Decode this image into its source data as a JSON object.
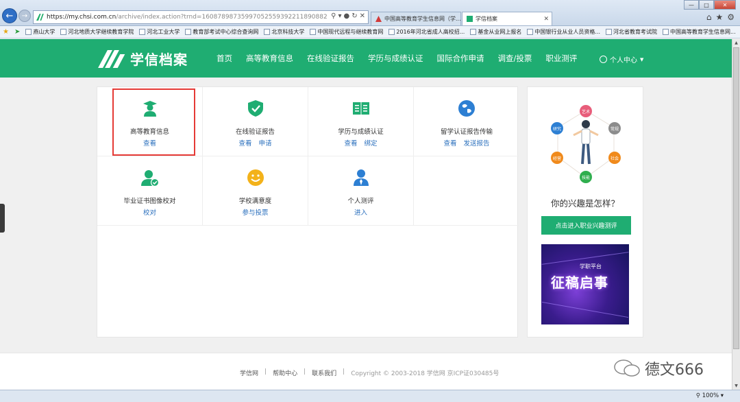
{
  "browser": {
    "url_main": "https://my.chsi.com.cn",
    "url_rest": "/archive/index.action?trnd=16087898735997052559392211890882",
    "tabs": [
      {
        "label": "中国高等教育学生信息网（学..."
      },
      {
        "label": "学信档案"
      }
    ],
    "favorites": [
      "燕山大学",
      "河北地质大学继续教育学院",
      "河北工业大学",
      "教育部考试中心综合查询网",
      "北京科技大学",
      "中国现代远程与继续教育网",
      "2016年河北省成人高校招...",
      "基金从业网上报名",
      "中国银行业从业人员资格...",
      "河北省教育考试院",
      "中国高等教育学生信息网..."
    ],
    "zoom": "100%"
  },
  "header": {
    "logo_text": "学信档案",
    "nav": [
      "首页",
      "高等教育信息",
      "在线验证报告",
      "学历与成绩认证",
      "国际合作申请",
      "调查/投票",
      "职业测评"
    ],
    "user_center": "个人中心"
  },
  "grid": [
    {
      "title": "高等教育信息",
      "links": [
        "查看"
      ],
      "icon": "graduate-icon",
      "color": "#1fad72"
    },
    {
      "title": "在线验证报告",
      "links": [
        "查看",
        "申请"
      ],
      "icon": "shield-check-icon",
      "color": "#1fad72"
    },
    {
      "title": "学历与成绩认证",
      "links": [
        "查看",
        "绑定"
      ],
      "icon": "book-icon",
      "color": "#1fad72"
    },
    {
      "title": "留学认证报告传输",
      "links": [
        "查看",
        "发送报告"
      ],
      "icon": "globe-icon",
      "color": "#2d7fd3"
    },
    {
      "title": "毕业证书图像校对",
      "links": [
        "校对"
      ],
      "icon": "user-check-icon",
      "color": "#1fad72"
    },
    {
      "title": "学校满意度",
      "links": [
        "参与投票"
      ],
      "icon": "smiley-icon",
      "color": "#f3b21a"
    },
    {
      "title": "个人测评",
      "links": [
        "进入"
      ],
      "icon": "person-tie-icon",
      "color": "#2d7fd3"
    }
  ],
  "side": {
    "interest_labels": [
      "艺术",
      "常规",
      "社会",
      "技能",
      "经营",
      "研究"
    ],
    "question": "你的兴趣是怎样？",
    "test_button": "点击进入职业兴趣测评",
    "promo_subtitle": "学职平台",
    "promo_title": "征稿启事"
  },
  "footer": {
    "links": [
      "学信网",
      "帮助中心",
      "联系我们"
    ],
    "copyright": "Copyright © 2003-2018 学信网 京ICP证030485号"
  },
  "watermark": "德文666",
  "colors": {
    "brand": "#1fad72",
    "link": "#2a6fbd",
    "highlight": "#e53935"
  }
}
